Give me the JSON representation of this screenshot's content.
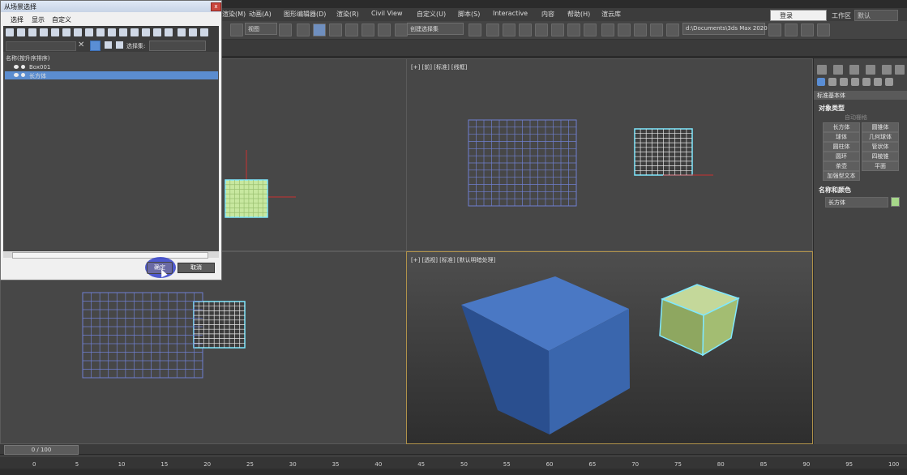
{
  "menubar": {
    "items": [
      "渲染(M)",
      "动画(A)",
      "图形编辑器(D)",
      "渲染(R)",
      "Civil View",
      "自定义(U)",
      "脚本(S)",
      "Interactive",
      "内容",
      "帮助(H)",
      "渲云库"
    ],
    "login": "登录",
    "workspace_label": "工作区",
    "workspace_value": "默认"
  },
  "toolbar": {
    "view_dropdown": "视图",
    "selection_set": "创建选择集",
    "project_path": "d:\\Documents\\3ds Max 2020"
  },
  "dialog": {
    "title": "从场景选择",
    "close": "x",
    "menus": [
      "选择",
      "显示",
      "自定义"
    ],
    "clear_glyph": "✕",
    "selset_label": "选择集:",
    "column_header": "名称(按升序排序)",
    "rows": [
      {
        "name": "Box001",
        "selected": false
      },
      {
        "name": "长方体",
        "selected": true
      }
    ],
    "ok": "确定",
    "cancel": "取消"
  },
  "viewports": {
    "top_right_label": "[+] [前] [标准] [线框]",
    "bottom_right_label": "[+] [透视] [标准] [默认明暗处理]"
  },
  "command_panel": {
    "category": "标准基本体",
    "object_type_title": "对象类型",
    "autogrid": "自动栅格",
    "buttons": [
      "长方体",
      "圆锥体",
      "球体",
      "几何球体",
      "圆柱体",
      "管状体",
      "圆环",
      "四棱锥",
      "茶壶",
      "平面",
      "加强型文本"
    ],
    "name_color_title": "名称和颜色",
    "object_name": "长方体",
    "object_color": "#a7d88a"
  },
  "timeline": {
    "frame_display": "0 / 100",
    "ticks": [
      "0",
      "5",
      "10",
      "15",
      "20",
      "25",
      "30",
      "35",
      "40",
      "45",
      "50",
      "55",
      "60",
      "65",
      "70",
      "75",
      "80",
      "85",
      "90",
      "95",
      "100"
    ]
  }
}
